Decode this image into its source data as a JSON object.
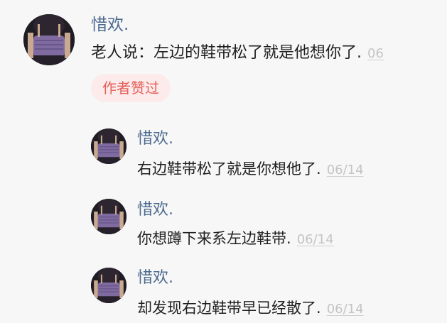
{
  "main_comment": {
    "author": "惜欢.",
    "text": "老人说：左边的鞋带松了就是他想你了.",
    "date": "06",
    "badge": "作者赞过"
  },
  "replies": [
    {
      "author": "惜欢.",
      "text": "右边鞋带松了就是你想他了.",
      "date": "06/14"
    },
    {
      "author": "惜欢.",
      "text": "你想蹲下来系左边鞋带.",
      "date": "06/14"
    },
    {
      "author": "惜欢.",
      "text": "却发现右边鞋带早已经散了.",
      "date": "06/14"
    }
  ],
  "colors": {
    "author": "#4d6a8e",
    "badge_bg": "#fdeaea",
    "badge_text": "#e4605a",
    "date": "#c4c4c4"
  },
  "icons": {
    "avatar": "user-photo-avatar"
  }
}
